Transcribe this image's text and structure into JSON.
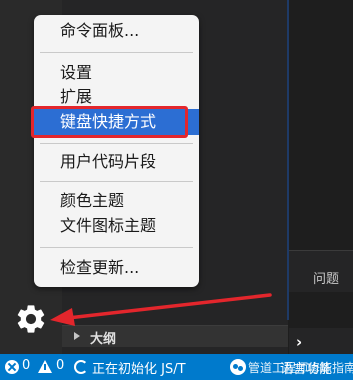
{
  "menu": {
    "items": [
      {
        "label": "命令面板..."
      },
      {
        "label": "设置"
      },
      {
        "label": "扩展"
      },
      {
        "label": "键盘快捷方式",
        "highlighted": true
      },
      {
        "label": "用户代码片段"
      },
      {
        "label": "颜色主题"
      },
      {
        "label": "文件图标主题"
      },
      {
        "label": "检查更新..."
      }
    ]
  },
  "panel": {
    "tab": "问题"
  },
  "sidebar": {
    "outline_label": "大纲"
  },
  "status_bar": {
    "errors": "0",
    "warnings": "0",
    "progress_text": "正在初始化 JS/T",
    "trailing_text": "语言功能"
  },
  "watermark": "管道工程师修炼指南",
  "icons": [
    "gear-icon",
    "error-icon",
    "warning-icon",
    "sync-spinner-icon",
    "chevron-right-icon",
    "chevron-right-small-icon"
  ],
  "colors": {
    "status_bar": "#007acc",
    "menu_background": "#f4f4f4",
    "menu_highlight": "#2c6ed3",
    "annotation_red": "#e3262c"
  }
}
